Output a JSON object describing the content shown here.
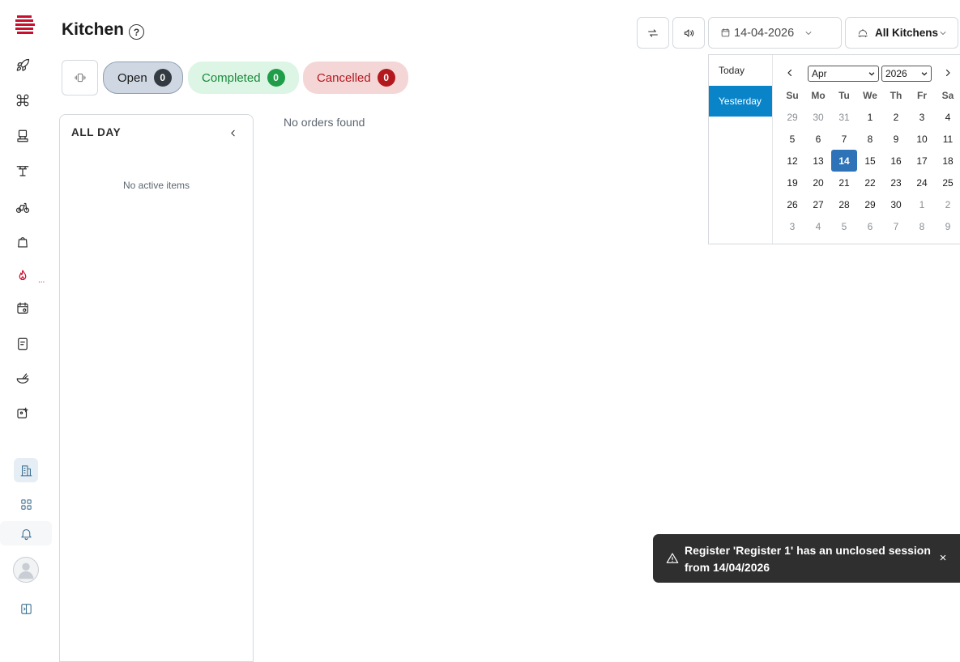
{
  "page": {
    "title": "Kitchen"
  },
  "header": {
    "date_value": "14-04-2026",
    "kitchen_label": "All Kitchens"
  },
  "filters": {
    "tabs": [
      {
        "label": "Open",
        "count": "0"
      },
      {
        "label": "Completed",
        "count": "0"
      },
      {
        "label": "Cancelled",
        "count": "0"
      }
    ]
  },
  "panel": {
    "title": "ALL DAY",
    "empty_text": "No active items"
  },
  "main": {
    "empty_text": "No orders found"
  },
  "sidebar": {
    "active_marker": "...",
    "icons": [
      "rocket-icon",
      "command-icon",
      "pos-terminal-icon",
      "table-icon",
      "bicycle-icon",
      "bag-icon",
      "flame-icon",
      "calendar-settings-icon",
      "receipt-icon",
      "food-bowl-icon",
      "image-plus-icon",
      "building-icon",
      "grid-icon",
      "bell-icon",
      "avatar",
      "panel-toggle-icon"
    ]
  },
  "datepicker": {
    "presets": [
      "Today",
      "Yesterday"
    ],
    "active_preset": "Yesterday",
    "month": "Apr",
    "year": "2026",
    "weekdays": [
      "Su",
      "Mo",
      "Tu",
      "We",
      "Th",
      "Fr",
      "Sa"
    ],
    "weeks": [
      [
        "29",
        "30",
        "31",
        "1",
        "2",
        "3",
        "4"
      ],
      [
        "5",
        "6",
        "7",
        "8",
        "9",
        "10",
        "11"
      ],
      [
        "12",
        "13",
        "14",
        "15",
        "16",
        "17",
        "18"
      ],
      [
        "19",
        "20",
        "21",
        "22",
        "23",
        "24",
        "25"
      ],
      [
        "26",
        "27",
        "28",
        "29",
        "30",
        "1",
        "2"
      ],
      [
        "3",
        "4",
        "5",
        "6",
        "7",
        "8",
        "9"
      ]
    ],
    "selected_day": "14"
  },
  "toast": {
    "message": "Register 'Register 1' has an unclosed session from 14/04/2026",
    "close": "×"
  },
  "colors": {
    "brand": "#c8102e",
    "preset_active": "#0a84c8",
    "selected_day": "#2e72b8",
    "toast_bg": "#2f2f2f"
  }
}
